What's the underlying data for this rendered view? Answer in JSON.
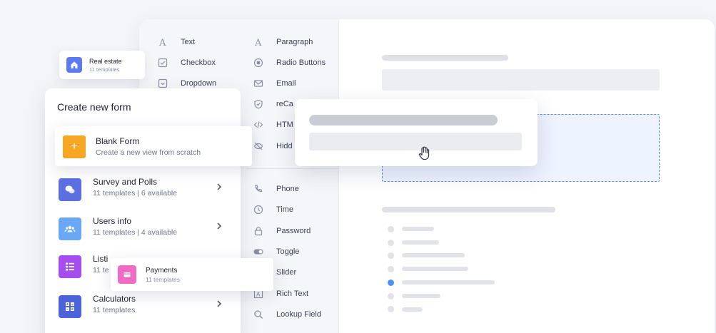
{
  "palette": {
    "fields_col1": [
      {
        "label": "Text",
        "icon": "text-icon"
      },
      {
        "label": "Checkbox",
        "icon": "checkbox-icon"
      },
      {
        "label": "Dropdown",
        "icon": "dropdown-icon"
      }
    ],
    "fields_col2": [
      {
        "label": "Paragraph",
        "icon": "paragraph-icon"
      },
      {
        "label": "Radio Buttons",
        "icon": "radio-icon"
      },
      {
        "label": "Email",
        "icon": "mail-icon"
      },
      {
        "label": "reCa",
        "icon": "shield-check-icon"
      },
      {
        "label": "HTM",
        "icon": "code-icon"
      },
      {
        "label": "Hidd",
        "icon": "eye-off-icon"
      },
      {
        "label": "Phone",
        "icon": "phone-icon"
      },
      {
        "label": "Time",
        "icon": "clock-icon"
      },
      {
        "label": "Password",
        "icon": "lock-icon"
      },
      {
        "label": "Toggle",
        "icon": "toggle-icon"
      },
      {
        "label": "Slider",
        "icon": "slider-icon"
      },
      {
        "label": "Rich Text",
        "icon": "rich-text-icon"
      },
      {
        "label": "Lookup Field",
        "icon": "search-icon"
      }
    ]
  },
  "chip_real_estate": {
    "title": "Real estate",
    "subtitle": "11 templates",
    "color": "#5b7cf0"
  },
  "create_form": {
    "heading": "Create new form",
    "blank": {
      "title": "Blank Form",
      "subtitle": "Create a new view from scratch",
      "plus": "+",
      "color": "#f5a623"
    },
    "categories": [
      {
        "title": "Survey and Polls",
        "subtitle": "11 templates  |  6 available",
        "color": "#5b6fe0",
        "icon": "chat-bubbles-icon"
      },
      {
        "title": "Users info",
        "subtitle": "11 templates  |  4 available",
        "color": "#6aa8f5",
        "icon": "users-icon"
      },
      {
        "title": "Listi",
        "subtitle": "11 te",
        "color": "#a64df0",
        "icon": "list-icon"
      },
      {
        "title": "Calculators",
        "subtitle": "11 templates",
        "color": "#4c63d9",
        "icon": "calculator-icon"
      }
    ]
  },
  "chip_payments": {
    "title": "Payments",
    "subtitle": "11 templates",
    "color": "#f06cc4"
  }
}
